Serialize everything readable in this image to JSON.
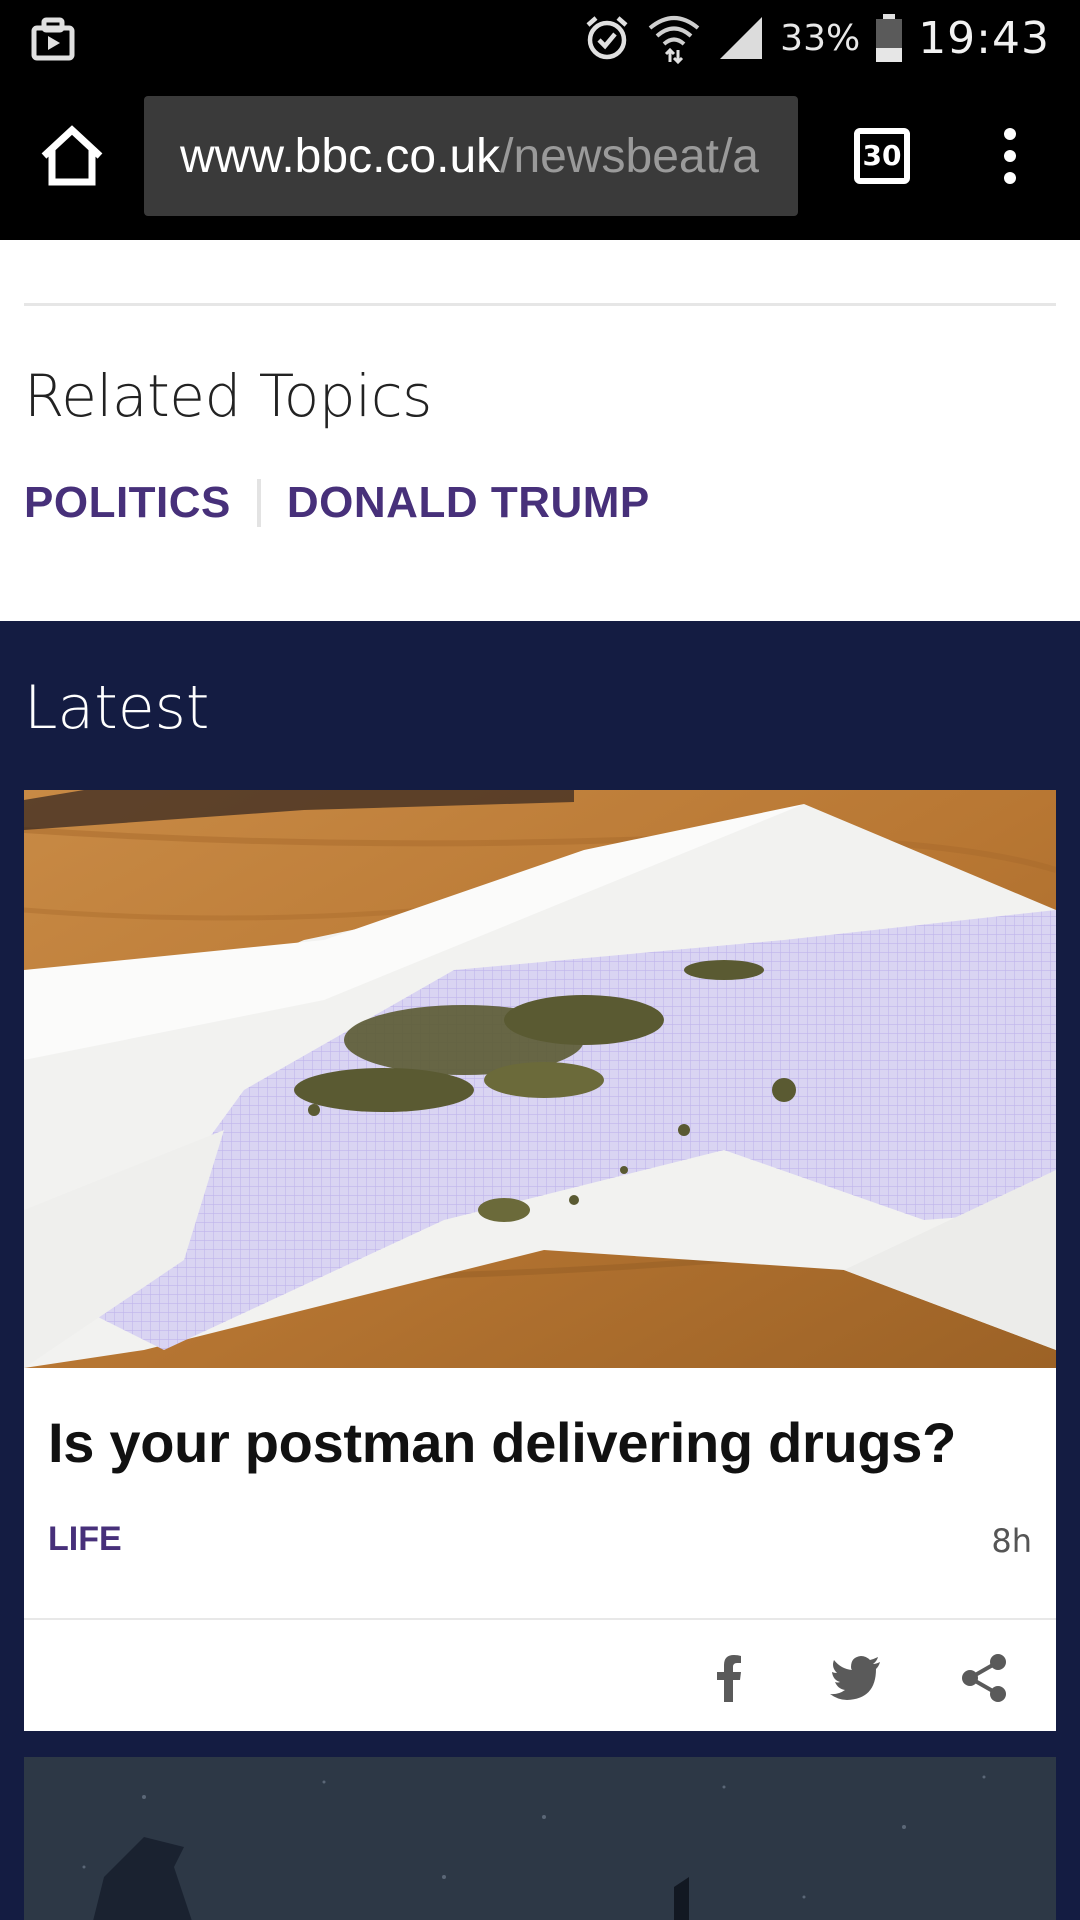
{
  "status_bar": {
    "battery": "33%",
    "time": "19:43",
    "icons": [
      "media-icon",
      "alarm-icon",
      "wifi-icon",
      "signal-icon",
      "battery-icon"
    ]
  },
  "browser": {
    "url_host": "www.bbc.co.uk",
    "url_path": "/newsbeat/a",
    "tab_count": "30",
    "icons": [
      "home-icon",
      "tabs-icon",
      "overflow-menu-icon"
    ]
  },
  "related": {
    "heading": "Related Topics",
    "topics": [
      "POLITICS",
      "DONALD TRUMP"
    ]
  },
  "latest": {
    "heading": "Latest",
    "colors": {
      "background": "#141c42",
      "accent": "#47307a"
    },
    "cards": [
      {
        "title": "Is your postman delivering drugs?",
        "tag": "LIFE",
        "time": "8h",
        "share_icons": [
          "facebook-icon",
          "twitter-icon",
          "share-icon"
        ]
      }
    ]
  }
}
